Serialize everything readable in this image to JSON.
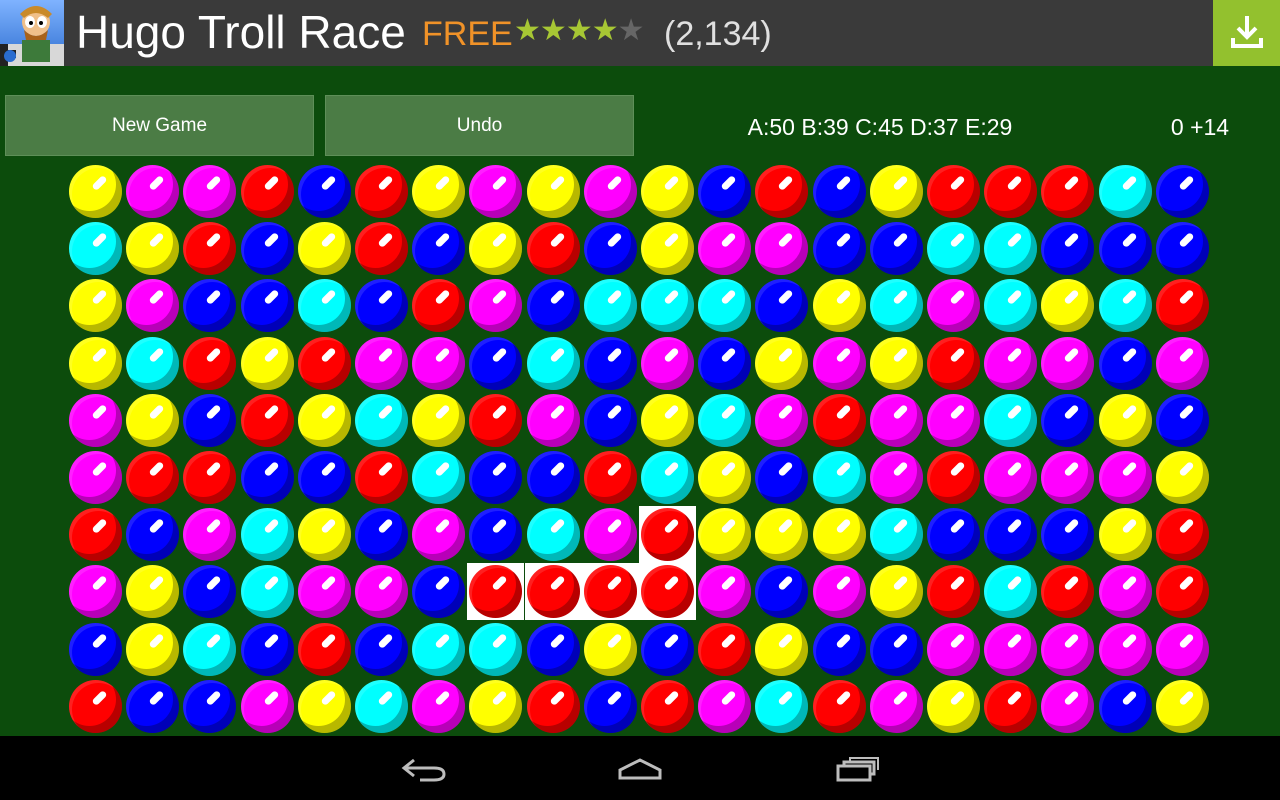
{
  "ad": {
    "title": "Hugo Troll Race",
    "price": "FREE",
    "rating": 4,
    "max_rating": 5,
    "reviews": "(2,134)",
    "icon": "hugo-troll-app-icon",
    "download_icon": "download-icon"
  },
  "toolbar": {
    "new_game_label": "New Game",
    "undo_label": "Undo"
  },
  "status": {
    "counts": "A:50 B:39 C:45 D:37 E:29",
    "score": "0 +14"
  },
  "colors": {
    "background": "#0c4c0c",
    "Y": "#ffff00",
    "M": "#ff00ff",
    "R": "#ff0000",
    "B": "#0000ff",
    "C": "#00ffff",
    "selection": "#ffffff"
  },
  "board": {
    "columns": 20,
    "rows": [
      "YMMRBRYMYMYBRBYRRRCB",
      "CYRBYRBYRBYMMBBCCBBB",
      "YMBBCBRMBCCCBYCMCYCR",
      "YCRYRMMBCBMBYMYRMMBM",
      "MYBRYCYRMBYCMRMMCBYB",
      "MRRBBRCBBRCYBCMRMMMY",
      "RBMCYBMBCMRYYYCBBBYR",
      "MYBCMMBRRRRMBMYRCRMR",
      "BYCBRBCCBYBRYBBMMMMM",
      "RBBMYCMYRBRMCRMYRMBY"
    ],
    "selected": [
      [
        6,
        10
      ],
      [
        7,
        7
      ],
      [
        7,
        8
      ],
      [
        7,
        9
      ],
      [
        7,
        10
      ]
    ]
  },
  "nav": {
    "back_icon": "back-icon",
    "home_icon": "home-icon",
    "recents_icon": "recent-apps-icon"
  }
}
